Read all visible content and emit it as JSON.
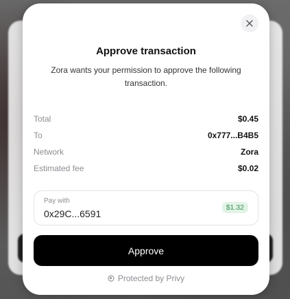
{
  "modal": {
    "title": "Approve transaction",
    "subtitle": "Zora wants your permission to approve the following transaction.",
    "close_icon": "close-icon"
  },
  "details": [
    {
      "label": "Total",
      "value": "$0.45"
    },
    {
      "label": "To",
      "value": "0x777...B4B5"
    },
    {
      "label": "Network",
      "value": "Zora"
    },
    {
      "label": "Estimated fee",
      "value": "$0.02"
    }
  ],
  "pay_with": {
    "label": "Pay with",
    "address": "0x29C...6591",
    "balance": "$1.32"
  },
  "approve_label": "Approve",
  "footer": {
    "text": "Protected by Privy",
    "icon": "privy-icon"
  },
  "colors": {
    "button": "#000000",
    "badge_bg": "#e2f3e6",
    "badge_text": "#3b8f54"
  }
}
